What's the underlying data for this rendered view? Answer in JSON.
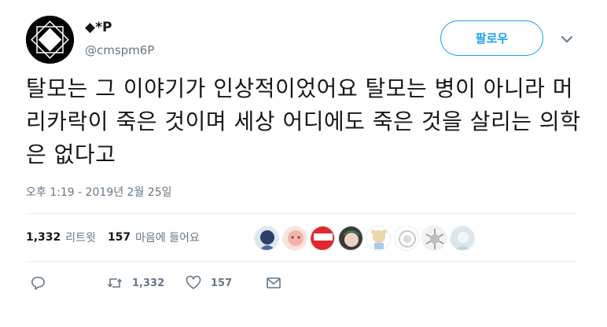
{
  "user": {
    "display_name": "◆*P",
    "handle": "@cmspm6P"
  },
  "follow_button_label": "팔로우",
  "tweet": {
    "text": "탈모는 그 이야기가 인상적이었어요 탈모는 병이 아니라 머리카락이 죽은 것이며 세상 어디에도 죽은 것을 살리는 의학은 없다고",
    "timestamp": "오후 1:19 - 2019년 2월 25일"
  },
  "stats": {
    "retweets_count": "1,332",
    "retweets_label": "리트윗",
    "likes_count": "157",
    "likes_label": "마음에 들어요"
  },
  "actions": {
    "retweet_count": "1,332",
    "like_count": "157"
  },
  "likers": [
    {
      "icon": "liker-avatar-1",
      "color": "#2c3e6b"
    },
    {
      "icon": "liker-avatar-2",
      "color": "#f4b3a8"
    },
    {
      "icon": "liker-avatar-3",
      "color": "#e0282e"
    },
    {
      "icon": "liker-avatar-4",
      "color": "#3a3a3a"
    },
    {
      "icon": "liker-avatar-5",
      "color": "#e9d7a8"
    },
    {
      "icon": "liker-avatar-6",
      "color": "#d9d9d9"
    },
    {
      "icon": "liker-avatar-7",
      "color": "#bfbfbf"
    },
    {
      "icon": "liker-avatar-8",
      "color": "#dbe6ec"
    }
  ],
  "colors": {
    "accent": "#1da1f2",
    "muted": "#657786",
    "text": "#14171a",
    "border": "#e6ecf0"
  }
}
